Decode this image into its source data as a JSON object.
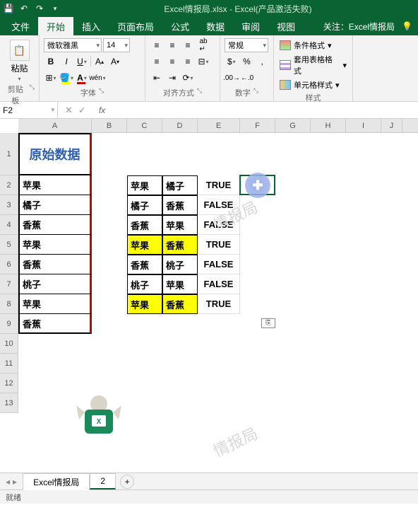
{
  "titlebar": {
    "title": "Excel情报局.xlsx - Excel(产品激活失败)"
  },
  "tabs": {
    "file": "文件",
    "home": "开始",
    "insert": "插入",
    "layout": "页面布局",
    "formula": "公式",
    "data": "数据",
    "review": "审阅",
    "view": "视图",
    "follow": "关注：Excel情报局"
  },
  "ribbon": {
    "clipboard": {
      "paste": "粘贴",
      "label": "剪贴板"
    },
    "font": {
      "name": "微软雅黑",
      "size": "14",
      "label": "字体"
    },
    "align": {
      "label": "对齐方式"
    },
    "number": {
      "format": "常规",
      "label": "数字"
    },
    "styles": {
      "cond": "条件格式",
      "table": "套用表格格式",
      "cell": "单元格样式",
      "label": "样式"
    }
  },
  "namebox": "F2",
  "cols": {
    "A": 104,
    "B": 50,
    "C": 50,
    "D": 50,
    "E": 60,
    "F": 50,
    "G": 50,
    "H": 50,
    "I": 50,
    "J": 30
  },
  "rowH": {
    "1": 60,
    "default": 28
  },
  "sheet": {
    "header_a1": "原始数据",
    "colA": [
      "苹果",
      "橘子",
      "香蕉",
      "苹果",
      "香蕉",
      "桃子",
      "苹果",
      "香蕉"
    ],
    "colC": [
      "苹果",
      "橘子",
      "香蕉",
      "苹果",
      "香蕉",
      "桃子",
      "苹果"
    ],
    "colD": [
      "橘子",
      "香蕉",
      "苹果",
      "香蕉",
      "桃子",
      "苹果",
      "香蕉"
    ],
    "colE": [
      "TRUE",
      "FALSE",
      "FALSE",
      "TRUE",
      "FALSE",
      "FALSE",
      "TRUE"
    ],
    "highlight_rows": [
      5,
      8
    ]
  },
  "watermark": "情报局",
  "tabs_bottom": {
    "t1": "Excel情报局",
    "t2": "2"
  },
  "status": "就绪"
}
